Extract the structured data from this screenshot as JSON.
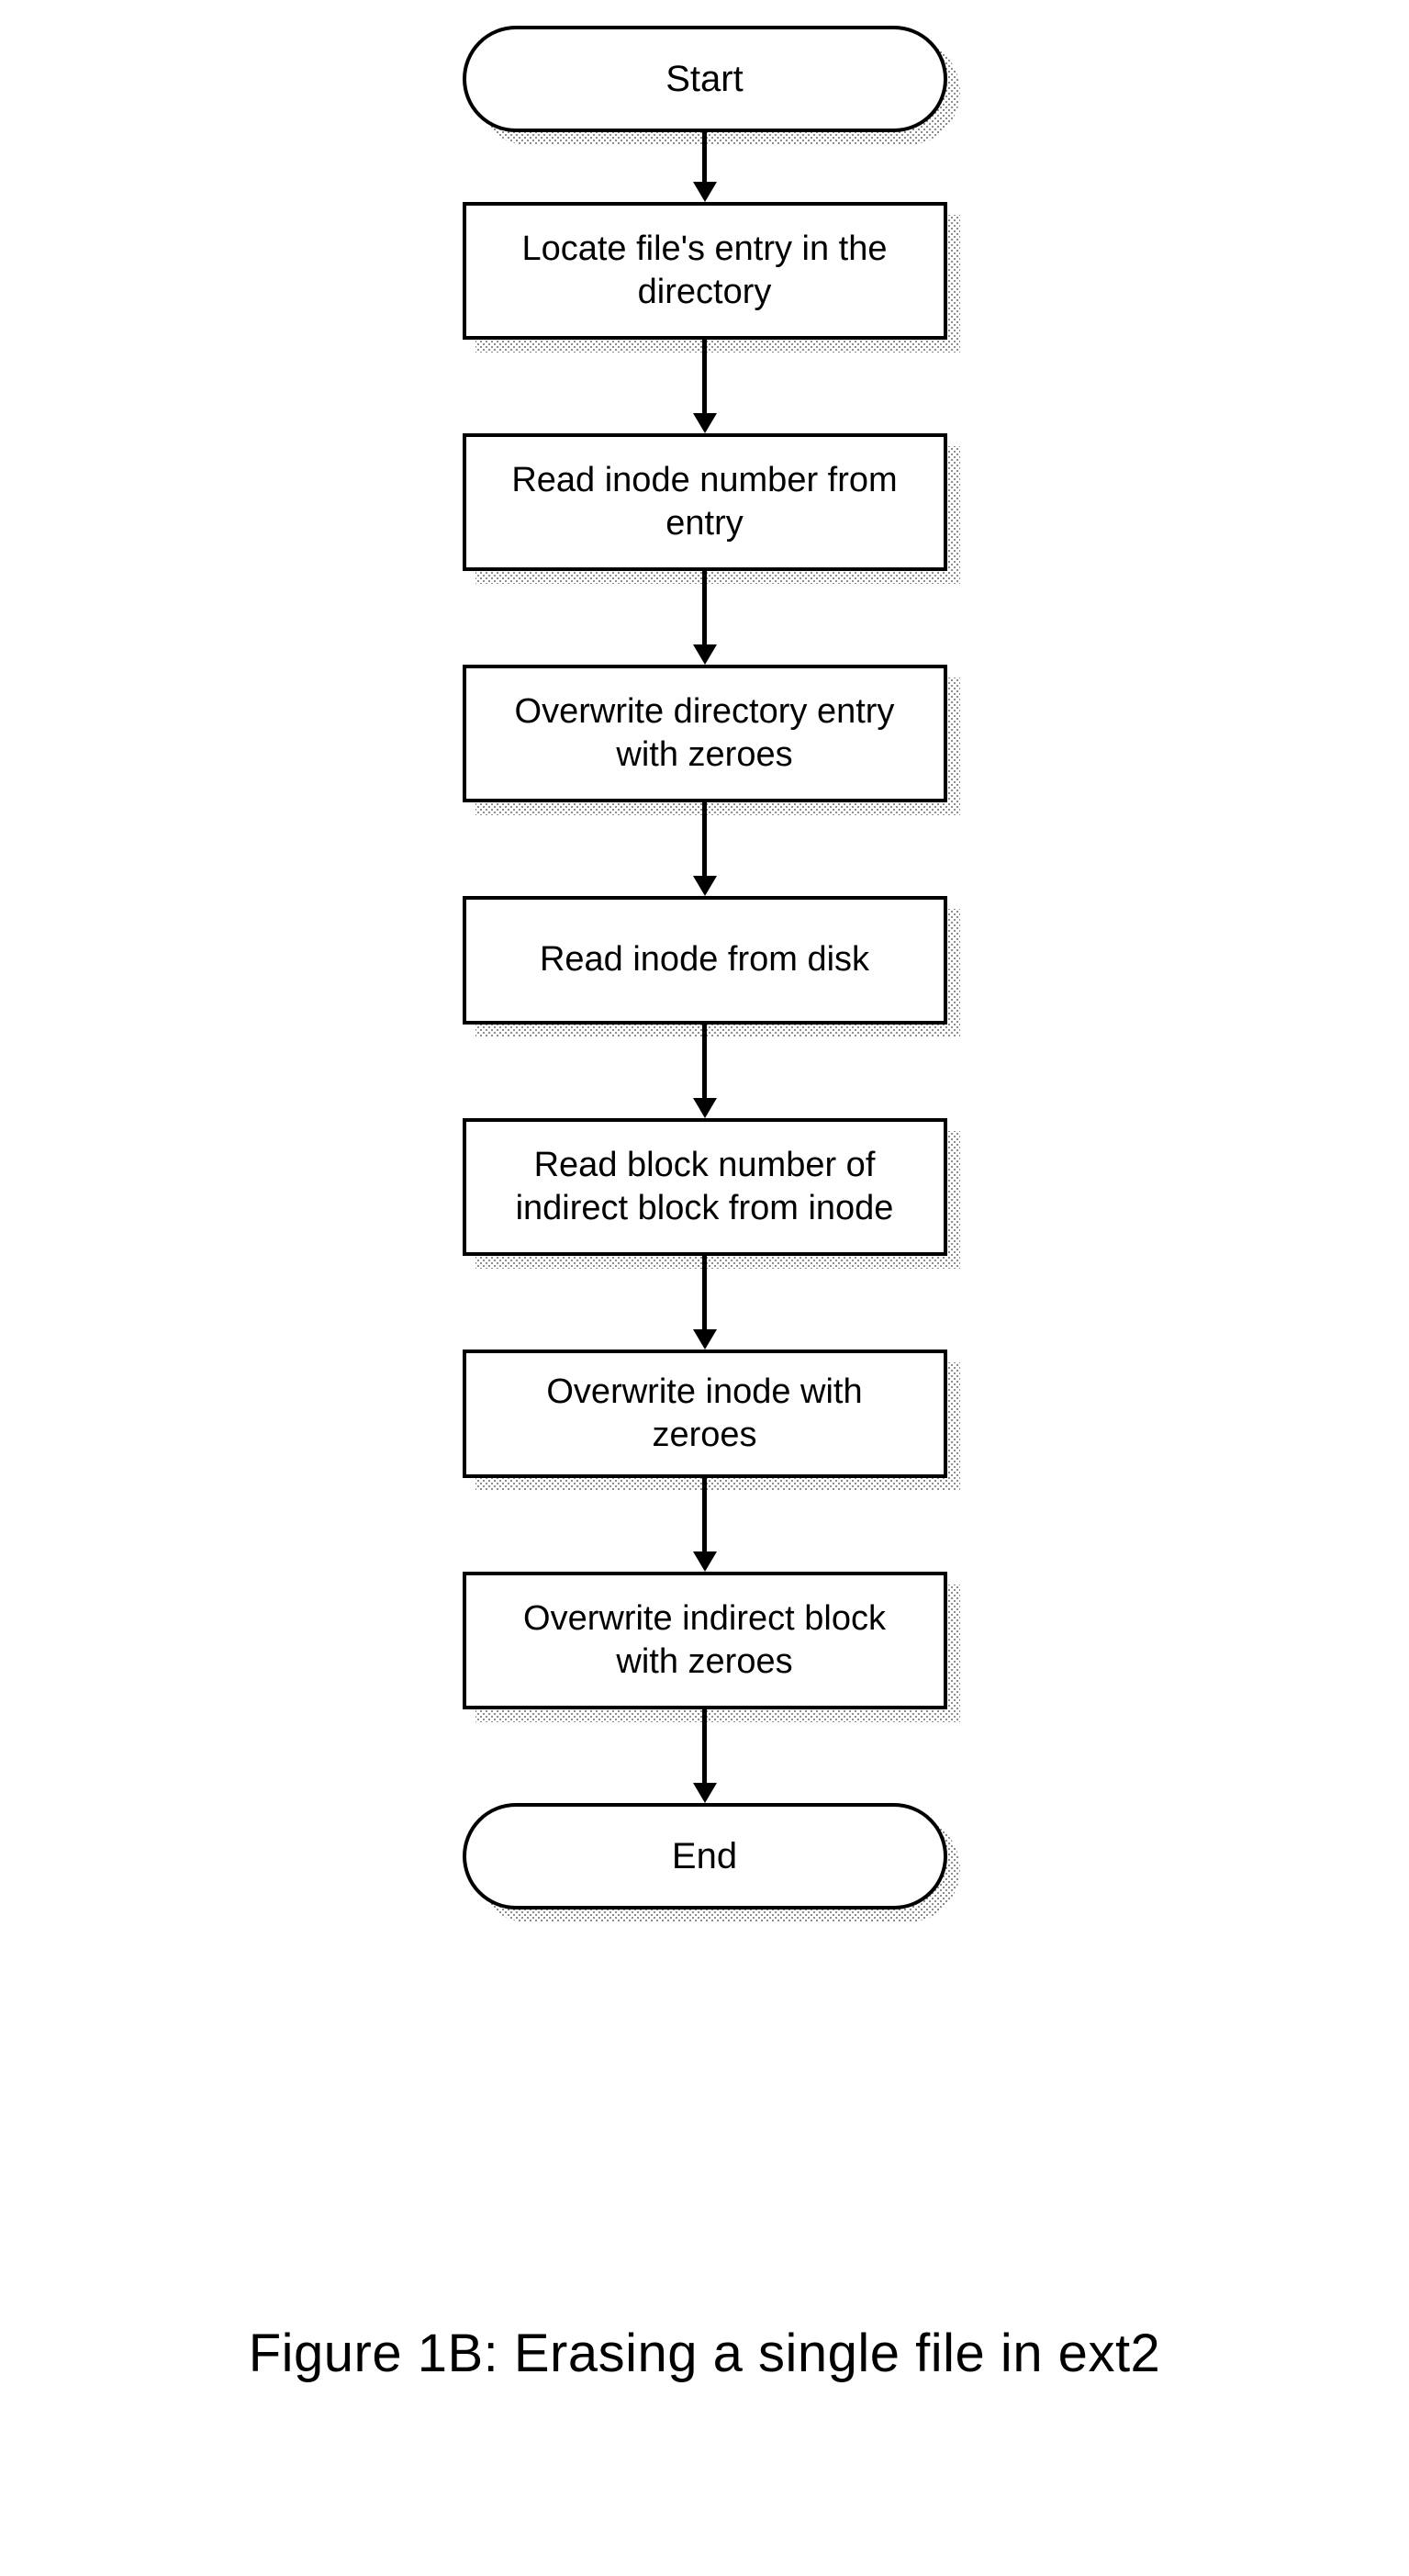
{
  "flowchart": {
    "start": "Start",
    "end": "End",
    "steps": [
      "Locate file's entry in the directory",
      "Read inode number from entry",
      "Overwrite directory entry with zeroes",
      "Read inode from disk",
      "Read block number of indirect block from inode",
      "Overwrite inode with zeroes",
      "Overwrite indirect block with zeroes"
    ]
  },
  "caption": "Figure 1B: Erasing a single file in ext2",
  "chart_data": {
    "type": "flowchart",
    "title": "Figure 1B: Erasing a single file in ext2",
    "direction": "top-to-bottom",
    "nodes": [
      {
        "id": "start",
        "shape": "terminator",
        "label": "Start"
      },
      {
        "id": "s1",
        "shape": "process",
        "label": "Locate file's entry in the directory"
      },
      {
        "id": "s2",
        "shape": "process",
        "label": "Read inode number from entry"
      },
      {
        "id": "s3",
        "shape": "process",
        "label": "Overwrite directory entry with zeroes"
      },
      {
        "id": "s4",
        "shape": "process",
        "label": "Read inode from disk"
      },
      {
        "id": "s5",
        "shape": "process",
        "label": "Read block number of indirect block from inode"
      },
      {
        "id": "s6",
        "shape": "process",
        "label": "Overwrite inode with zeroes"
      },
      {
        "id": "s7",
        "shape": "process",
        "label": "Overwrite indirect block with zeroes"
      },
      {
        "id": "end",
        "shape": "terminator",
        "label": "End"
      }
    ],
    "edges": [
      {
        "from": "start",
        "to": "s1"
      },
      {
        "from": "s1",
        "to": "s2"
      },
      {
        "from": "s2",
        "to": "s3"
      },
      {
        "from": "s3",
        "to": "s4"
      },
      {
        "from": "s4",
        "to": "s5"
      },
      {
        "from": "s5",
        "to": "s6"
      },
      {
        "from": "s6",
        "to": "s7"
      },
      {
        "from": "s7",
        "to": "end"
      }
    ]
  }
}
